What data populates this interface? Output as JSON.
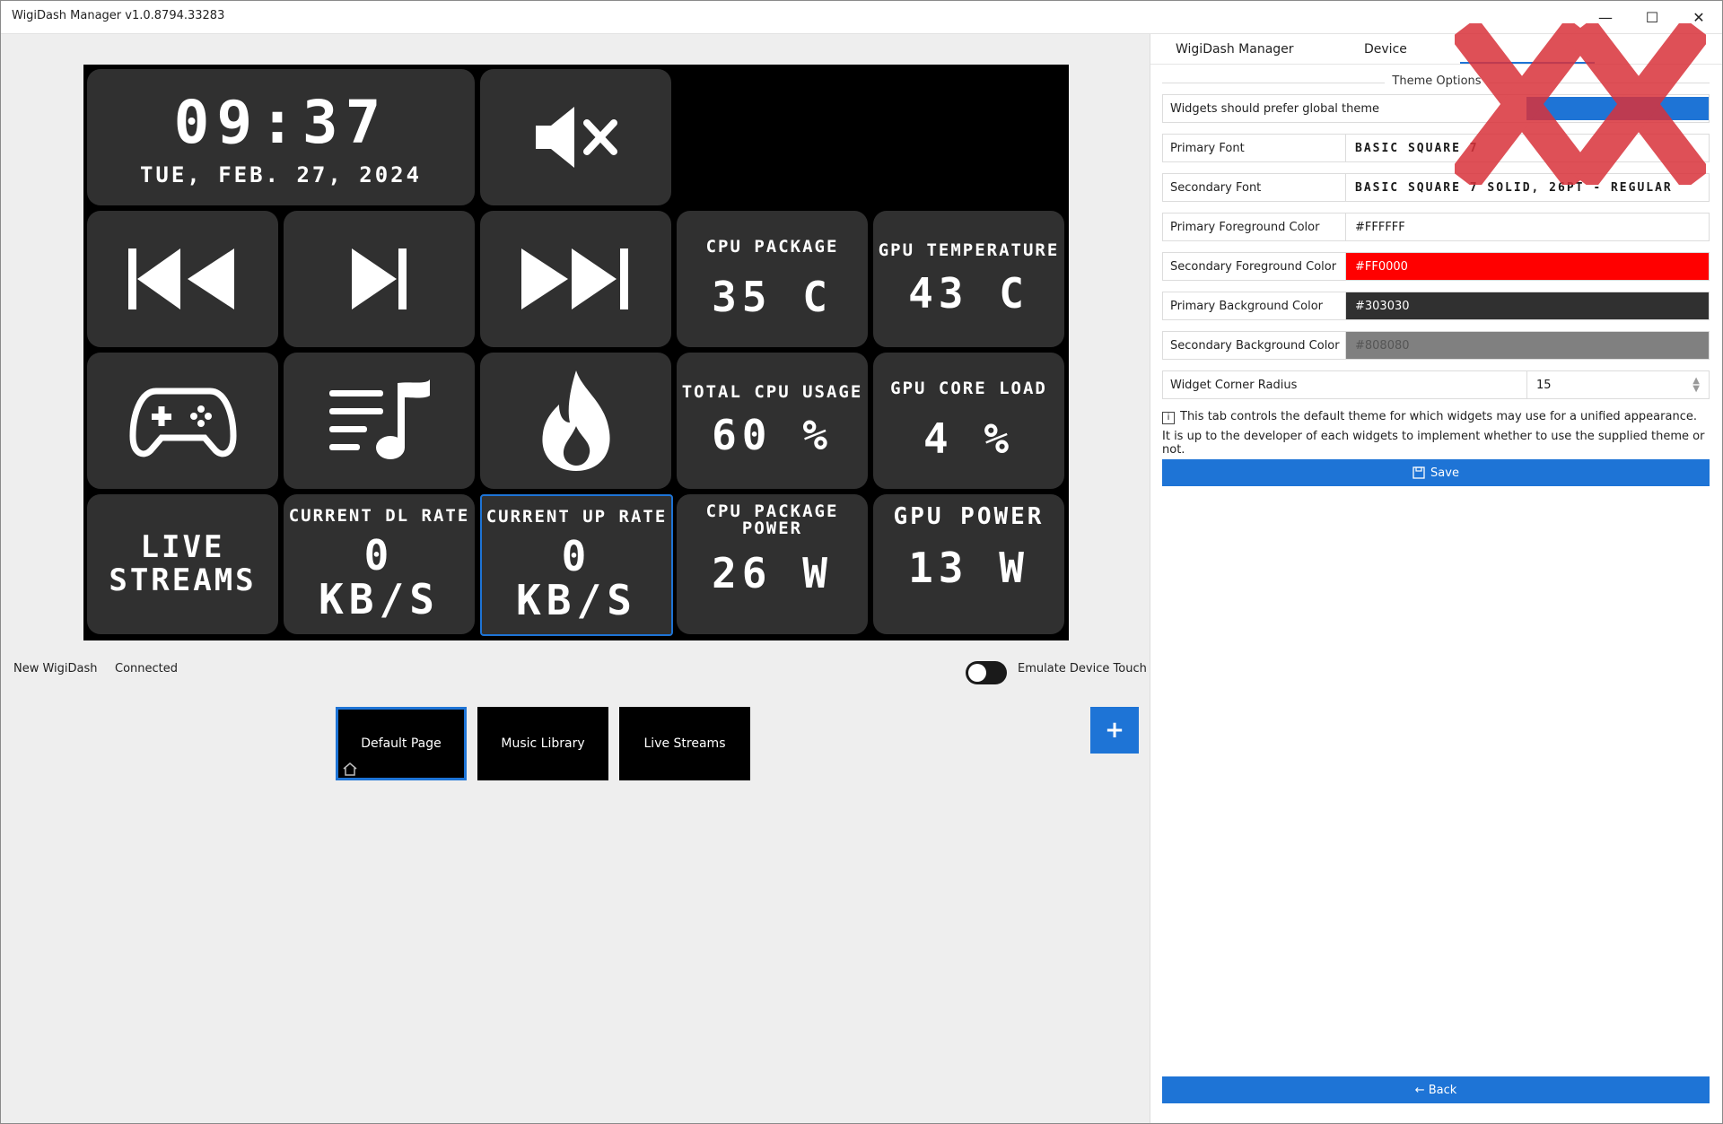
{
  "window": {
    "title": "WigiDash Manager v1.0.8794.33283",
    "minimize": "—",
    "maximize": "☐",
    "close": "✕"
  },
  "device": {
    "clock": {
      "time": "09:37",
      "date": "TUE, FEB. 27, 2024"
    },
    "tiles": {
      "cpu_package": {
        "label": "CPU PACKAGE",
        "value": "35 C"
      },
      "gpu_temp": {
        "label": "GPU TEMPERATURE",
        "value": "43 C"
      },
      "total_cpu": {
        "label": "TOTAL CPU USAGE",
        "value": "60 %"
      },
      "gpu_core": {
        "label": "GPU CORE LOAD",
        "value": "4 %"
      },
      "live_streams": {
        "label": "LIVE STREAMS"
      },
      "dl_rate": {
        "label": "CURRENT DL RATE",
        "value": "0",
        "unit": "KB/S"
      },
      "up_rate": {
        "label": "CURRENT UP RATE",
        "value": "0",
        "unit": "KB/S"
      },
      "cpu_power": {
        "label": "CPU PACKAGE POWER",
        "value": "26 W"
      },
      "gpu_power": {
        "label": "GPU POWER",
        "value": "13 W"
      }
    }
  },
  "status": {
    "device_name": "New WigiDash",
    "connection": "Connected",
    "emulate_label": "Emulate Device Touch",
    "emulate_on": false
  },
  "pages": [
    {
      "label": "Default Page",
      "active": true
    },
    {
      "label": "Music Library",
      "active": false
    },
    {
      "label": "Live Streams",
      "active": false
    }
  ],
  "add_page_label": "+",
  "tabs": [
    "WigiDash Manager",
    "Device"
  ],
  "theme": {
    "section_title": "Theme Options",
    "prefer_global_label": "Widgets should prefer global theme",
    "primary_font_label": "Primary Font",
    "primary_font_value": "BASIC SQUARE 7",
    "secondary_font_label": "Secondary Font",
    "secondary_font_value": "BASIC SQUARE 7 SOLID, 26PT - REGULAR",
    "primary_fg_label": "Primary Foreground Color",
    "primary_fg_value": "#FFFFFF",
    "secondary_fg_label": "Secondary Foreground Color",
    "secondary_fg_value": "#FF0000",
    "primary_bg_label": "Primary Background Color",
    "primary_bg_value": "#303030",
    "secondary_bg_label": "Secondary Background Color",
    "secondary_bg_value": "#808080",
    "corner_radius_label": "Widget Corner Radius",
    "corner_radius_value": "15",
    "info_line1": "This tab controls the default theme for which widgets may use for a unified appearance.",
    "info_line2": "It is up to the developer of each widgets to implement whether to use the supplied theme or not.",
    "save_label": "Save",
    "back_label": "← Back"
  },
  "colors": {
    "accent": "#1e74d6",
    "tile_bg": "#303030",
    "watermark": "#d9323a"
  }
}
